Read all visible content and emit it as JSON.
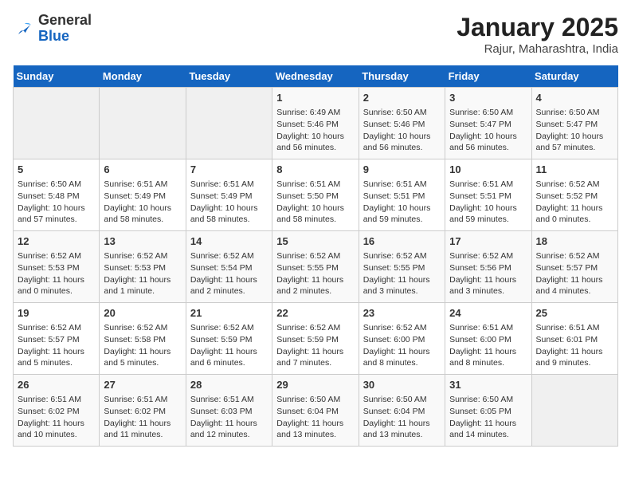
{
  "header": {
    "logo_general": "General",
    "logo_blue": "Blue",
    "month": "January 2025",
    "location": "Rajur, Maharashtra, India"
  },
  "weekdays": [
    "Sunday",
    "Monday",
    "Tuesday",
    "Wednesday",
    "Thursday",
    "Friday",
    "Saturday"
  ],
  "weeks": [
    [
      {
        "day": "",
        "empty": true
      },
      {
        "day": "",
        "empty": true
      },
      {
        "day": "",
        "empty": true
      },
      {
        "day": "1",
        "sunrise": "6:49 AM",
        "sunset": "5:46 PM",
        "daylight": "10 hours and 56 minutes."
      },
      {
        "day": "2",
        "sunrise": "6:50 AM",
        "sunset": "5:46 PM",
        "daylight": "10 hours and 56 minutes."
      },
      {
        "day": "3",
        "sunrise": "6:50 AM",
        "sunset": "5:47 PM",
        "daylight": "10 hours and 56 minutes."
      },
      {
        "day": "4",
        "sunrise": "6:50 AM",
        "sunset": "5:47 PM",
        "daylight": "10 hours and 57 minutes."
      }
    ],
    [
      {
        "day": "5",
        "sunrise": "6:50 AM",
        "sunset": "5:48 PM",
        "daylight": "10 hours and 57 minutes."
      },
      {
        "day": "6",
        "sunrise": "6:51 AM",
        "sunset": "5:49 PM",
        "daylight": "10 hours and 58 minutes."
      },
      {
        "day": "7",
        "sunrise": "6:51 AM",
        "sunset": "5:49 PM",
        "daylight": "10 hours and 58 minutes."
      },
      {
        "day": "8",
        "sunrise": "6:51 AM",
        "sunset": "5:50 PM",
        "daylight": "10 hours and 58 minutes."
      },
      {
        "day": "9",
        "sunrise": "6:51 AM",
        "sunset": "5:51 PM",
        "daylight": "10 hours and 59 minutes."
      },
      {
        "day": "10",
        "sunrise": "6:51 AM",
        "sunset": "5:51 PM",
        "daylight": "10 hours and 59 minutes."
      },
      {
        "day": "11",
        "sunrise": "6:52 AM",
        "sunset": "5:52 PM",
        "daylight": "11 hours and 0 minutes."
      }
    ],
    [
      {
        "day": "12",
        "sunrise": "6:52 AM",
        "sunset": "5:53 PM",
        "daylight": "11 hours and 0 minutes."
      },
      {
        "day": "13",
        "sunrise": "6:52 AM",
        "sunset": "5:53 PM",
        "daylight": "11 hours and 1 minute."
      },
      {
        "day": "14",
        "sunrise": "6:52 AM",
        "sunset": "5:54 PM",
        "daylight": "11 hours and 2 minutes."
      },
      {
        "day": "15",
        "sunrise": "6:52 AM",
        "sunset": "5:55 PM",
        "daylight": "11 hours and 2 minutes."
      },
      {
        "day": "16",
        "sunrise": "6:52 AM",
        "sunset": "5:55 PM",
        "daylight": "11 hours and 3 minutes."
      },
      {
        "day": "17",
        "sunrise": "6:52 AM",
        "sunset": "5:56 PM",
        "daylight": "11 hours and 3 minutes."
      },
      {
        "day": "18",
        "sunrise": "6:52 AM",
        "sunset": "5:57 PM",
        "daylight": "11 hours and 4 minutes."
      }
    ],
    [
      {
        "day": "19",
        "sunrise": "6:52 AM",
        "sunset": "5:57 PM",
        "daylight": "11 hours and 5 minutes."
      },
      {
        "day": "20",
        "sunrise": "6:52 AM",
        "sunset": "5:58 PM",
        "daylight": "11 hours and 5 minutes."
      },
      {
        "day": "21",
        "sunrise": "6:52 AM",
        "sunset": "5:59 PM",
        "daylight": "11 hours and 6 minutes."
      },
      {
        "day": "22",
        "sunrise": "6:52 AM",
        "sunset": "5:59 PM",
        "daylight": "11 hours and 7 minutes."
      },
      {
        "day": "23",
        "sunrise": "6:52 AM",
        "sunset": "6:00 PM",
        "daylight": "11 hours and 8 minutes."
      },
      {
        "day": "24",
        "sunrise": "6:51 AM",
        "sunset": "6:00 PM",
        "daylight": "11 hours and 8 minutes."
      },
      {
        "day": "25",
        "sunrise": "6:51 AM",
        "sunset": "6:01 PM",
        "daylight": "11 hours and 9 minutes."
      }
    ],
    [
      {
        "day": "26",
        "sunrise": "6:51 AM",
        "sunset": "6:02 PM",
        "daylight": "11 hours and 10 minutes."
      },
      {
        "day": "27",
        "sunrise": "6:51 AM",
        "sunset": "6:02 PM",
        "daylight": "11 hours and 11 minutes."
      },
      {
        "day": "28",
        "sunrise": "6:51 AM",
        "sunset": "6:03 PM",
        "daylight": "11 hours and 12 minutes."
      },
      {
        "day": "29",
        "sunrise": "6:50 AM",
        "sunset": "6:04 PM",
        "daylight": "11 hours and 13 minutes."
      },
      {
        "day": "30",
        "sunrise": "6:50 AM",
        "sunset": "6:04 PM",
        "daylight": "11 hours and 13 minutes."
      },
      {
        "day": "31",
        "sunrise": "6:50 AM",
        "sunset": "6:05 PM",
        "daylight": "11 hours and 14 minutes."
      },
      {
        "day": "",
        "empty": true
      }
    ]
  ]
}
